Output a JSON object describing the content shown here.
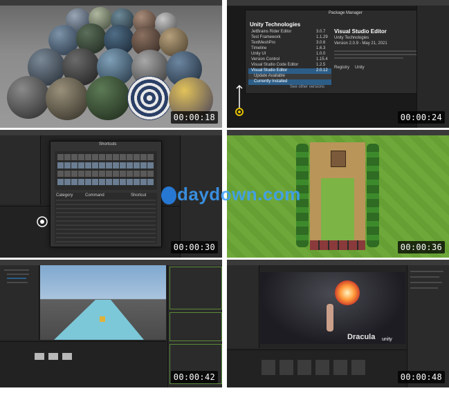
{
  "thumbnails": [
    {
      "timestamp": "00:00:18",
      "scene": "material-spheres"
    },
    {
      "timestamp": "00:00:24",
      "scene": "package-manager"
    },
    {
      "timestamp": "00:00:30",
      "scene": "shortcuts-window"
    },
    {
      "timestamp": "00:00:36",
      "scene": "tile-map-level"
    },
    {
      "timestamp": "00:00:42",
      "scene": "runner-track"
    },
    {
      "timestamp": "00:00:48",
      "scene": "fire-spell-character"
    }
  ],
  "package_manager": {
    "window_title": "Package Manager",
    "header": "Unity Technologies",
    "packages": [
      {
        "name": "JetBrains Rider Editor",
        "version": "3.0.7"
      },
      {
        "name": "Test Framework",
        "version": "1.1.29"
      },
      {
        "name": "TextMeshPro",
        "version": "3.0.6"
      },
      {
        "name": "Timeline",
        "version": "1.6.3"
      },
      {
        "name": "Unity UI",
        "version": "1.0.0"
      },
      {
        "name": "Version Control",
        "version": "1.15.4"
      },
      {
        "name": "Visual Studio Code Editor",
        "version": "1.2.5"
      },
      {
        "name": "Visual Studio Editor",
        "version": "2.0.12"
      }
    ],
    "update_available": "Update Available",
    "currently_installed": "Currently Installed",
    "see_other_versions": "See other versions",
    "selected_title": "Visual Studio Editor",
    "selected_publisher": "Unity Technologies",
    "selected_version": "Version 2.0.9 - May 21, 2021",
    "registry_label": "Registry",
    "registry_value": "Unity"
  },
  "shortcuts": {
    "window_title": "Shortcuts",
    "columns": [
      "Category",
      "Command",
      "Shortcut"
    ]
  },
  "unity_logo": "unity",
  "scene_title": "Dracula",
  "watermark": "daydown.com",
  "colors": {
    "editor_dark": "#1e1e1e",
    "panel": "#262626",
    "accent_blue": "#2c5d87",
    "watermark_blue": "#3ca0ff",
    "grass": "#6fa83a",
    "sky": "#8fb4d8"
  }
}
